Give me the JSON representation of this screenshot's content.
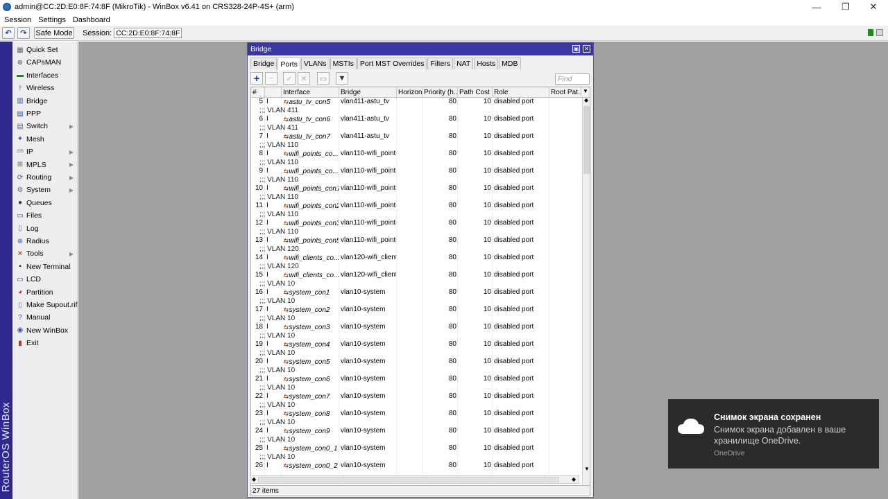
{
  "window": {
    "title": "admin@CC:2D:E0:8F:74:8F (MikroTik) - WinBox v6.41 on CRS328-24P-4S+ (arm)",
    "minimize": "—",
    "maximize": "❐",
    "close": "✕"
  },
  "menubar": [
    "Session",
    "Settings",
    "Dashboard"
  ],
  "toolbar": {
    "undo_icon": "↶",
    "redo_icon": "↷",
    "safe_mode": "Safe Mode",
    "session_label": "Session:",
    "session_value": "CC:2D:E0:8F:74:8F",
    "indicator_green": "#1a8a1a"
  },
  "sidebar": {
    "brand_text": "RouterOS WinBox",
    "items": [
      {
        "label": "Quick Set",
        "icon": "quick-set-icon",
        "glyph": "▦",
        "color": "#6a6a6a",
        "submenu": false
      },
      {
        "label": "CAPsMAN",
        "icon": "capsman-icon",
        "glyph": "⊕",
        "color": "#555",
        "submenu": false
      },
      {
        "label": "Interfaces",
        "icon": "interfaces-icon",
        "glyph": "▬",
        "color": "#2d7a2d",
        "submenu": false
      },
      {
        "label": "Wireless",
        "icon": "wireless-icon",
        "glyph": "⫯",
        "color": "#555",
        "submenu": false
      },
      {
        "label": "Bridge",
        "icon": "bridge-icon",
        "glyph": "▥",
        "color": "#2a56b5",
        "submenu": false
      },
      {
        "label": "PPP",
        "icon": "ppp-icon",
        "glyph": "▤",
        "color": "#2a56b5",
        "submenu": false
      },
      {
        "label": "Switch",
        "icon": "switch-icon",
        "glyph": "▤",
        "color": "#666",
        "submenu": true
      },
      {
        "label": "Mesh",
        "icon": "mesh-icon",
        "glyph": "✦",
        "color": "#2a56b5",
        "submenu": false
      },
      {
        "label": "IP",
        "icon": "ip-icon",
        "glyph": "255",
        "color": "#666",
        "submenu": true
      },
      {
        "label": "MPLS",
        "icon": "mpls-icon",
        "glyph": "⊞",
        "color": "#666",
        "submenu": true
      },
      {
        "label": "Routing",
        "icon": "routing-icon",
        "glyph": "⟳",
        "color": "#2a56b5",
        "submenu": true
      },
      {
        "label": "System",
        "icon": "system-icon",
        "glyph": "⚙",
        "color": "#666",
        "submenu": true
      },
      {
        "label": "Queues",
        "icon": "queues-icon",
        "glyph": "●",
        "color": "#333",
        "submenu": false
      },
      {
        "label": "Files",
        "icon": "files-icon",
        "glyph": "▭",
        "color": "#2a56b5",
        "submenu": false
      },
      {
        "label": "Log",
        "icon": "log-icon",
        "glyph": "▯",
        "color": "#777",
        "submenu": false
      },
      {
        "label": "Radius",
        "icon": "radius-icon",
        "glyph": "⊛",
        "color": "#2a56b5",
        "submenu": false
      },
      {
        "label": "Tools",
        "icon": "tools-icon",
        "glyph": "✕",
        "color": "#b03020",
        "submenu": true
      },
      {
        "label": "New Terminal",
        "icon": "terminal-icon",
        "glyph": "▪",
        "color": "#222",
        "submenu": false
      },
      {
        "label": "LCD",
        "icon": "lcd-icon",
        "glyph": "▭",
        "color": "#2a56b5",
        "submenu": false
      },
      {
        "label": "Partition",
        "icon": "partition-icon",
        "glyph": "◕",
        "color": "#c03030",
        "submenu": false
      },
      {
        "label": "Make Supout.rif",
        "icon": "supout-icon",
        "glyph": "▯",
        "color": "#777",
        "submenu": false
      },
      {
        "label": "Manual",
        "icon": "manual-icon",
        "glyph": "?",
        "color": "#2a56b5",
        "submenu": false
      },
      {
        "label": "New WinBox",
        "icon": "new-winbox-icon",
        "glyph": "◉",
        "color": "#2a56b5",
        "submenu": false
      },
      {
        "label": "Exit",
        "icon": "exit-icon",
        "glyph": "▮",
        "color": "#a04010",
        "submenu": false
      }
    ]
  },
  "bridge_window": {
    "title": "Bridge",
    "restore_icon": "▣",
    "close_icon": "✕",
    "tabs": [
      "Bridge",
      "Ports",
      "VLANs",
      "MSTIs",
      "Port MST Overrides",
      "Filters",
      "NAT",
      "Hosts",
      "MDB"
    ],
    "active_tab": "Ports",
    "tools": {
      "add": "+",
      "remove": "−",
      "enable": "✓",
      "disable": "✕",
      "comment": "▭",
      "filter": "▼"
    },
    "find_placeholder": "Find",
    "columns": [
      "#",
      "",
      "Interface",
      "Bridge",
      "Horizon",
      "Priority (h...",
      "Path Cost",
      "Role",
      "Root Pat..."
    ],
    "column_dropdown": "▼",
    "rows": [
      {
        "num": "5",
        "flag": "I",
        "iface": "astu_tv_con5",
        "bridge": "vlan411-astu_tv",
        "horizon": "",
        "priority": "80",
        "cost": "10",
        "role": "disabled port",
        "comment": ";;; VLAN 411"
      },
      {
        "num": "6",
        "flag": "I",
        "iface": "astu_tv_con6",
        "bridge": "vlan411-astu_tv",
        "horizon": "",
        "priority": "80",
        "cost": "10",
        "role": "disabled port",
        "comment": ";;; VLAN 411"
      },
      {
        "num": "7",
        "flag": "I",
        "iface": "astu_tv_con7",
        "bridge": "vlan411-astu_tv",
        "horizon": "",
        "priority": "80",
        "cost": "10",
        "role": "disabled port",
        "comment": ";;; VLAN 110"
      },
      {
        "num": "8",
        "flag": "I",
        "iface": "wifi_points_co...",
        "bridge": "vlan110-wifi_points",
        "horizon": "",
        "priority": "80",
        "cost": "10",
        "role": "disabled port",
        "comment": ";;; VLAN 110"
      },
      {
        "num": "9",
        "flag": "I",
        "iface": "wifi_points_co...",
        "bridge": "vlan110-wifi_points",
        "horizon": "",
        "priority": "80",
        "cost": "10",
        "role": "disabled port",
        "comment": ";;; VLAN 110"
      },
      {
        "num": "10",
        "flag": "I",
        "iface": "wifi_points_con1",
        "bridge": "vlan110-wifi_points",
        "horizon": "",
        "priority": "80",
        "cost": "10",
        "role": "disabled port",
        "comment": ";;; VLAN 110"
      },
      {
        "num": "11",
        "flag": "I",
        "iface": "wifi_points_con2",
        "bridge": "vlan110-wifi_points",
        "horizon": "",
        "priority": "80",
        "cost": "10",
        "role": "disabled port",
        "comment": ";;; VLAN 110"
      },
      {
        "num": "12",
        "flag": "I",
        "iface": "wifi_points_con3",
        "bridge": "vlan110-wifi_points",
        "horizon": "",
        "priority": "80",
        "cost": "10",
        "role": "disabled port",
        "comment": ";;; VLAN 110"
      },
      {
        "num": "13",
        "flag": "I",
        "iface": "wifi_points_con5",
        "bridge": "vlan110-wifi_points",
        "horizon": "",
        "priority": "80",
        "cost": "10",
        "role": "disabled port",
        "comment": ";;; VLAN 120"
      },
      {
        "num": "14",
        "flag": "I",
        "iface": "wifi_clients_co...",
        "bridge": "vlan120-wifi_clients",
        "horizon": "",
        "priority": "80",
        "cost": "10",
        "role": "disabled port",
        "comment": ";;; VLAN 120"
      },
      {
        "num": "15",
        "flag": "I",
        "iface": "wifi_clients_co...",
        "bridge": "vlan120-wifi_clients",
        "horizon": "",
        "priority": "80",
        "cost": "10",
        "role": "disabled port",
        "comment": ";;; VLAN 10"
      },
      {
        "num": "16",
        "flag": "I",
        "iface": "system_con1",
        "bridge": "vlan10-system",
        "horizon": "",
        "priority": "80",
        "cost": "10",
        "role": "disabled port",
        "comment": ";;; VLAN 10"
      },
      {
        "num": "17",
        "flag": "I",
        "iface": "system_con2",
        "bridge": "vlan10-system",
        "horizon": "",
        "priority": "80",
        "cost": "10",
        "role": "disabled port",
        "comment": ";;; VLAN 10"
      },
      {
        "num": "18",
        "flag": "I",
        "iface": "system_con3",
        "bridge": "vlan10-system",
        "horizon": "",
        "priority": "80",
        "cost": "10",
        "role": "disabled port",
        "comment": ";;; VLAN 10"
      },
      {
        "num": "19",
        "flag": "I",
        "iface": "system_con4",
        "bridge": "vlan10-system",
        "horizon": "",
        "priority": "80",
        "cost": "10",
        "role": "disabled port",
        "comment": ";;; VLAN 10"
      },
      {
        "num": "20",
        "flag": "I",
        "iface": "system_con5",
        "bridge": "vlan10-system",
        "horizon": "",
        "priority": "80",
        "cost": "10",
        "role": "disabled port",
        "comment": ";;; VLAN 10"
      },
      {
        "num": "21",
        "flag": "I",
        "iface": "system_con6",
        "bridge": "vlan10-system",
        "horizon": "",
        "priority": "80",
        "cost": "10",
        "role": "disabled port",
        "comment": ";;; VLAN 10"
      },
      {
        "num": "22",
        "flag": "I",
        "iface": "system_con7",
        "bridge": "vlan10-system",
        "horizon": "",
        "priority": "80",
        "cost": "10",
        "role": "disabled port",
        "comment": ";;; VLAN 10"
      },
      {
        "num": "23",
        "flag": "I",
        "iface": "system_con8",
        "bridge": "vlan10-system",
        "horizon": "",
        "priority": "80",
        "cost": "10",
        "role": "disabled port",
        "comment": ";;; VLAN 10"
      },
      {
        "num": "24",
        "flag": "I",
        "iface": "system_con9",
        "bridge": "vlan10-system",
        "horizon": "",
        "priority": "80",
        "cost": "10",
        "role": "disabled port",
        "comment": ";;; VLAN 10"
      },
      {
        "num": "25",
        "flag": "I",
        "iface": "system_con0_1",
        "bridge": "vlan10-system",
        "horizon": "",
        "priority": "80",
        "cost": "10",
        "role": "disabled port",
        "comment": ";;; VLAN 10"
      },
      {
        "num": "26",
        "flag": "I",
        "iface": "system_con0_2",
        "bridge": "vlan10-system",
        "horizon": "",
        "priority": "80",
        "cost": "10",
        "role": "disabled port",
        "comment": ""
      }
    ],
    "iface_icon": "⇆",
    "item_count": "27 items"
  },
  "toast": {
    "title": "Снимок экрана сохранен",
    "body": "Снимок экрана добавлен в ваше хранилище OneDrive.",
    "source": "OneDrive",
    "icon": "cloud-icon"
  }
}
